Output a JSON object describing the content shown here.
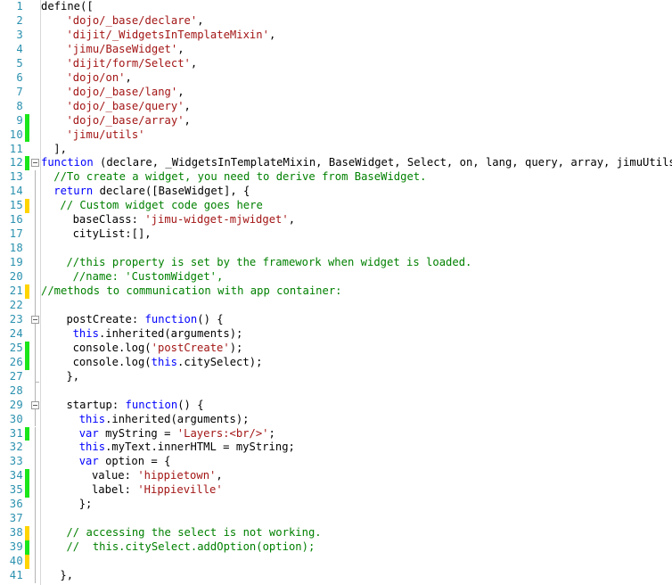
{
  "editor": {
    "language": "javascript",
    "colors": {
      "background": "#ffffff",
      "line_number": "#2b91af",
      "keyword": "#0000ff",
      "string": "#a31515",
      "comment": "#008000",
      "plain": "#000000",
      "marker_saved": "#1ae61a",
      "marker_unsaved": "#ffd400",
      "gutter_rule": "#d8d8d8"
    },
    "first_line": 1,
    "last_line": 41,
    "lines": [
      {
        "n": "1",
        "marker": "none",
        "fold": "none",
        "guide": "none",
        "indent": 0,
        "tokens": [
          {
            "t": "plain",
            "s": "define(["
          }
        ]
      },
      {
        "n": "2",
        "marker": "none",
        "fold": "none",
        "guide": "none",
        "indent": 4,
        "tokens": [
          {
            "t": "string",
            "s": "'dojo/_base/declare'"
          },
          {
            "t": "plain",
            "s": ","
          }
        ]
      },
      {
        "n": "3",
        "marker": "none",
        "fold": "none",
        "guide": "none",
        "indent": 4,
        "tokens": [
          {
            "t": "string",
            "s": "'dijit/_WidgetsInTemplateMixin'"
          },
          {
            "t": "plain",
            "s": ","
          }
        ]
      },
      {
        "n": "4",
        "marker": "none",
        "fold": "none",
        "guide": "none",
        "indent": 4,
        "tokens": [
          {
            "t": "string",
            "s": "'jimu/BaseWidget'"
          },
          {
            "t": "plain",
            "s": ","
          }
        ]
      },
      {
        "n": "5",
        "marker": "none",
        "fold": "none",
        "guide": "none",
        "indent": 4,
        "tokens": [
          {
            "t": "string",
            "s": "'dijit/form/Select'"
          },
          {
            "t": "plain",
            "s": ","
          }
        ]
      },
      {
        "n": "6",
        "marker": "none",
        "fold": "none",
        "guide": "none",
        "indent": 4,
        "tokens": [
          {
            "t": "string",
            "s": "'dojo/on'"
          },
          {
            "t": "plain",
            "s": ","
          }
        ]
      },
      {
        "n": "7",
        "marker": "none",
        "fold": "none",
        "guide": "none",
        "indent": 4,
        "tokens": [
          {
            "t": "string",
            "s": "'dojo/_base/lang'"
          },
          {
            "t": "plain",
            "s": ","
          }
        ]
      },
      {
        "n": "8",
        "marker": "none",
        "fold": "none",
        "guide": "none",
        "indent": 4,
        "tokens": [
          {
            "t": "string",
            "s": "'dojo/_base/query'"
          },
          {
            "t": "plain",
            "s": ","
          }
        ]
      },
      {
        "n": "9",
        "marker": "saved",
        "fold": "none",
        "guide": "none",
        "indent": 4,
        "tokens": [
          {
            "t": "string",
            "s": "'dojo/_base/array'"
          },
          {
            "t": "plain",
            "s": ","
          }
        ]
      },
      {
        "n": "10",
        "marker": "saved",
        "fold": "none",
        "guide": "none",
        "indent": 4,
        "tokens": [
          {
            "t": "string",
            "s": "'jimu/utils'"
          }
        ]
      },
      {
        "n": "11",
        "marker": "none",
        "fold": "none",
        "guide": "none",
        "indent": 2,
        "tokens": [
          {
            "t": "plain",
            "s": "],"
          }
        ]
      },
      {
        "n": "12",
        "marker": "saved",
        "fold": "open",
        "guide": "none",
        "indent": 0,
        "tokens": [
          {
            "t": "keyword",
            "s": "function"
          },
          {
            "t": "plain",
            "s": " (declare, _WidgetsInTemplateMixin, BaseWidget, Select, on, lang, query, array, jimuUtils) {"
          }
        ]
      },
      {
        "n": "13",
        "marker": "none",
        "fold": "none",
        "guide": "line",
        "indent": 2,
        "tokens": [
          {
            "t": "comment",
            "s": "//To create a widget, you need to derive from BaseWidget."
          }
        ]
      },
      {
        "n": "14",
        "marker": "none",
        "fold": "none",
        "guide": "line",
        "indent": 2,
        "tokens": [
          {
            "t": "keyword",
            "s": "return"
          },
          {
            "t": "plain",
            "s": " declare([BaseWidget], {"
          }
        ]
      },
      {
        "n": "15",
        "marker": "unsaved",
        "fold": "none",
        "guide": "line",
        "indent": 3,
        "tokens": [
          {
            "t": "comment",
            "s": "// Custom widget code goes here"
          }
        ]
      },
      {
        "n": "16",
        "marker": "none",
        "fold": "none",
        "guide": "line",
        "indent": 5,
        "tokens": [
          {
            "t": "plain",
            "s": "baseClass: "
          },
          {
            "t": "string",
            "s": "'jimu-widget-mjwidget'"
          },
          {
            "t": "plain",
            "s": ","
          }
        ]
      },
      {
        "n": "17",
        "marker": "none",
        "fold": "none",
        "guide": "line",
        "indent": 5,
        "tokens": [
          {
            "t": "plain",
            "s": "cityList:[],"
          }
        ]
      },
      {
        "n": "18",
        "marker": "none",
        "fold": "none",
        "guide": "line",
        "indent": 0,
        "tokens": [
          {
            "t": "plain",
            "s": ""
          }
        ]
      },
      {
        "n": "19",
        "marker": "none",
        "fold": "none",
        "guide": "line",
        "indent": 4,
        "tokens": [
          {
            "t": "comment",
            "s": "//this property is set by the framework when widget is loaded."
          }
        ]
      },
      {
        "n": "20",
        "marker": "none",
        "fold": "none",
        "guide": "line",
        "indent": 5,
        "tokens": [
          {
            "t": "comment",
            "s": "//name: 'CustomWidget',"
          }
        ]
      },
      {
        "n": "21",
        "marker": "unsaved",
        "fold": "none",
        "guide": "line",
        "indent": 0,
        "tokens": [
          {
            "t": "comment",
            "s": "//methods to communication with app container:"
          }
        ]
      },
      {
        "n": "22",
        "marker": "none",
        "fold": "none",
        "guide": "line",
        "indent": 0,
        "tokens": [
          {
            "t": "plain",
            "s": ""
          }
        ]
      },
      {
        "n": "23",
        "marker": "none",
        "fold": "open",
        "guide": "line",
        "indent": 4,
        "tokens": [
          {
            "t": "plain",
            "s": "postCreate: "
          },
          {
            "t": "keyword",
            "s": "function"
          },
          {
            "t": "plain",
            "s": "() {"
          }
        ]
      },
      {
        "n": "24",
        "marker": "none",
        "fold": "none",
        "guide": "line",
        "indent": 5,
        "tokens": [
          {
            "t": "keyword",
            "s": "this"
          },
          {
            "t": "plain",
            "s": ".inherited(arguments);"
          }
        ]
      },
      {
        "n": "25",
        "marker": "saved",
        "fold": "none",
        "guide": "line",
        "indent": 5,
        "tokens": [
          {
            "t": "plain",
            "s": "console.log("
          },
          {
            "t": "string",
            "s": "'postCreate'"
          },
          {
            "t": "plain",
            "s": ");"
          }
        ]
      },
      {
        "n": "26",
        "marker": "saved",
        "fold": "none",
        "guide": "line",
        "indent": 5,
        "tokens": [
          {
            "t": "plain",
            "s": "console.log("
          },
          {
            "t": "keyword",
            "s": "this"
          },
          {
            "t": "plain",
            "s": ".citySelect);"
          }
        ]
      },
      {
        "n": "27",
        "marker": "none",
        "fold": "end",
        "guide": "line",
        "indent": 4,
        "tokens": [
          {
            "t": "plain",
            "s": "},"
          }
        ]
      },
      {
        "n": "28",
        "marker": "none",
        "fold": "none",
        "guide": "line",
        "indent": 0,
        "tokens": [
          {
            "t": "plain",
            "s": ""
          }
        ]
      },
      {
        "n": "29",
        "marker": "none",
        "fold": "open",
        "guide": "line",
        "indent": 4,
        "tokens": [
          {
            "t": "plain",
            "s": "startup: "
          },
          {
            "t": "keyword",
            "s": "function"
          },
          {
            "t": "plain",
            "s": "() {"
          }
        ]
      },
      {
        "n": "30",
        "marker": "none",
        "fold": "none",
        "guide": "line",
        "indent": 6,
        "tokens": [
          {
            "t": "keyword",
            "s": "this"
          },
          {
            "t": "plain",
            "s": ".inherited(arguments);"
          }
        ]
      },
      {
        "n": "31",
        "marker": "saved",
        "fold": "none",
        "guide": "line",
        "indent": 6,
        "tokens": [
          {
            "t": "keyword",
            "s": "var"
          },
          {
            "t": "plain",
            "s": " myString = "
          },
          {
            "t": "string",
            "s": "'Layers:<br/>'"
          },
          {
            "t": "plain",
            "s": ";"
          }
        ]
      },
      {
        "n": "32",
        "marker": "none",
        "fold": "none",
        "guide": "line",
        "indent": 6,
        "tokens": [
          {
            "t": "keyword",
            "s": "this"
          },
          {
            "t": "plain",
            "s": ".myText.innerHTML = myString;"
          }
        ]
      },
      {
        "n": "33",
        "marker": "none",
        "fold": "none",
        "guide": "line",
        "indent": 6,
        "tokens": [
          {
            "t": "keyword",
            "s": "var"
          },
          {
            "t": "plain",
            "s": " option = {"
          }
        ]
      },
      {
        "n": "34",
        "marker": "saved",
        "fold": "none",
        "guide": "line",
        "indent": 8,
        "tokens": [
          {
            "t": "plain",
            "s": "value: "
          },
          {
            "t": "string",
            "s": "'hippietown'"
          },
          {
            "t": "plain",
            "s": ","
          }
        ]
      },
      {
        "n": "35",
        "marker": "saved",
        "fold": "none",
        "guide": "line",
        "indent": 8,
        "tokens": [
          {
            "t": "plain",
            "s": "label: "
          },
          {
            "t": "string",
            "s": "'Hippieville'"
          }
        ]
      },
      {
        "n": "36",
        "marker": "none",
        "fold": "none",
        "guide": "line",
        "indent": 6,
        "tokens": [
          {
            "t": "plain",
            "s": "};"
          }
        ]
      },
      {
        "n": "37",
        "marker": "none",
        "fold": "none",
        "guide": "line",
        "indent": 0,
        "tokens": [
          {
            "t": "plain",
            "s": ""
          }
        ]
      },
      {
        "n": "38",
        "marker": "unsaved",
        "fold": "none",
        "guide": "line",
        "indent": 4,
        "tokens": [
          {
            "t": "comment",
            "s": "// accessing the select is not working."
          }
        ]
      },
      {
        "n": "39",
        "marker": "saved",
        "fold": "none",
        "guide": "line",
        "indent": 4,
        "tokens": [
          {
            "t": "comment",
            "s": "//  this.citySelect.addOption(option);"
          }
        ]
      },
      {
        "n": "40",
        "marker": "unsaved",
        "fold": "none",
        "guide": "line",
        "indent": 0,
        "tokens": [
          {
            "t": "plain",
            "s": ""
          }
        ]
      },
      {
        "n": "41",
        "marker": "none",
        "fold": "none",
        "guide": "line",
        "indent": 3,
        "tokens": [
          {
            "t": "plain",
            "s": "},"
          }
        ]
      }
    ]
  }
}
